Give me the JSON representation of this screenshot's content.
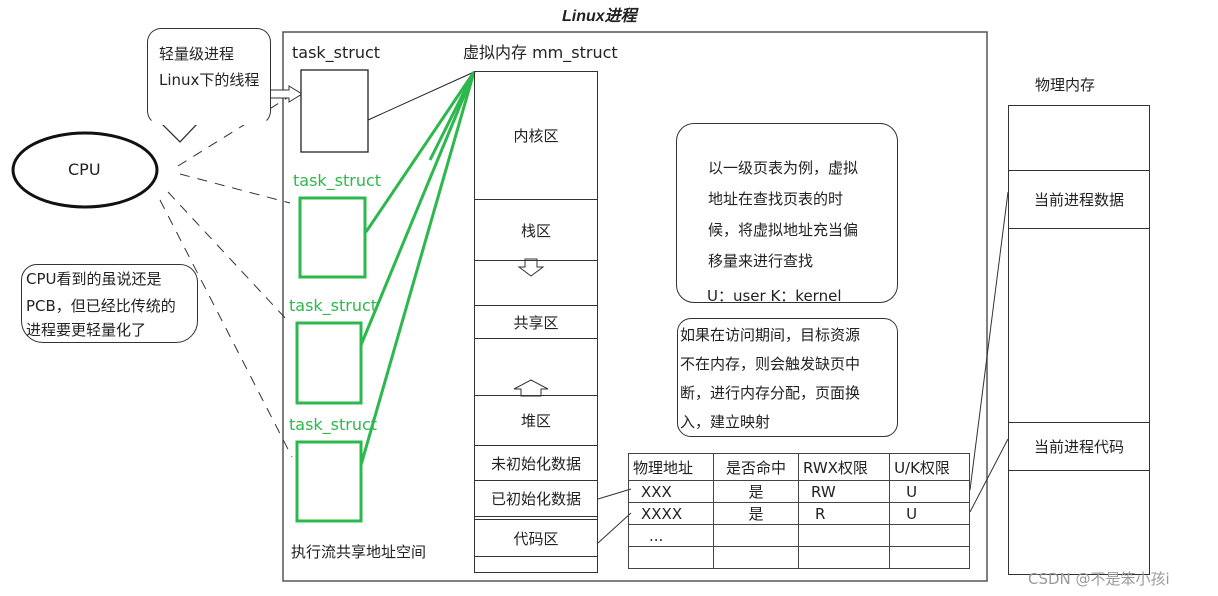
{
  "title": "Linux进程",
  "colors": {
    "green": "#2db84d",
    "line": "#333333"
  },
  "cpu": {
    "label": "CPU"
  },
  "bubbles": {
    "lightweight": {
      "lines": [
        "轻量级进程",
        "Linux下的线程"
      ]
    },
    "cpu_view": {
      "lines": [
        "CPU看到的虽说还是",
        "PCB，但已经比传统的",
        "进程要更轻量化了"
      ]
    },
    "page_table_note": {
      "lines": [
        "以一级页表为例，虚拟",
        "地址在查找页表的时",
        "候，将虚拟地址充当偏",
        "移量来进行查找"
      ],
      "legend": "U：user  K：kernel"
    },
    "page_fault_note": {
      "lines": [
        "如果在访问期间，目标资源",
        "不在内存，则会触发缺页中",
        "断，进行内存分配，页面换",
        "入，建立映射"
      ]
    }
  },
  "task_structs": [
    {
      "label": "task_struct",
      "color": "black"
    },
    {
      "label": "task_struct",
      "color": "green"
    },
    {
      "label": "task_struct",
      "color": "green"
    },
    {
      "label": "task_struct",
      "color": "green"
    }
  ],
  "shared_space_label": "执行流共享地址空间",
  "virtual_memory": {
    "label": "虚拟内存 mm_struct",
    "segments": [
      "内核区",
      "栈区",
      "",
      "共享区",
      "",
      "堆区",
      "未初始化数据",
      "已初始化数据",
      "代码区",
      ""
    ]
  },
  "page_table": {
    "headers": [
      "物理地址",
      "是否命中",
      "RWX权限",
      "U/K权限"
    ],
    "rows": [
      [
        "XXX",
        "是",
        "RW",
        "U"
      ],
      [
        "XXXX",
        "是",
        "R",
        "U"
      ],
      [
        "...",
        "",
        "",
        ""
      ],
      [
        "",
        "",
        "",
        ""
      ]
    ]
  },
  "physical_memory": {
    "label": "物理内存",
    "segments": [
      "",
      "当前进程数据",
      "",
      "当前进程代码",
      ""
    ]
  },
  "watermark": "CSDN @不是笨小孩i"
}
